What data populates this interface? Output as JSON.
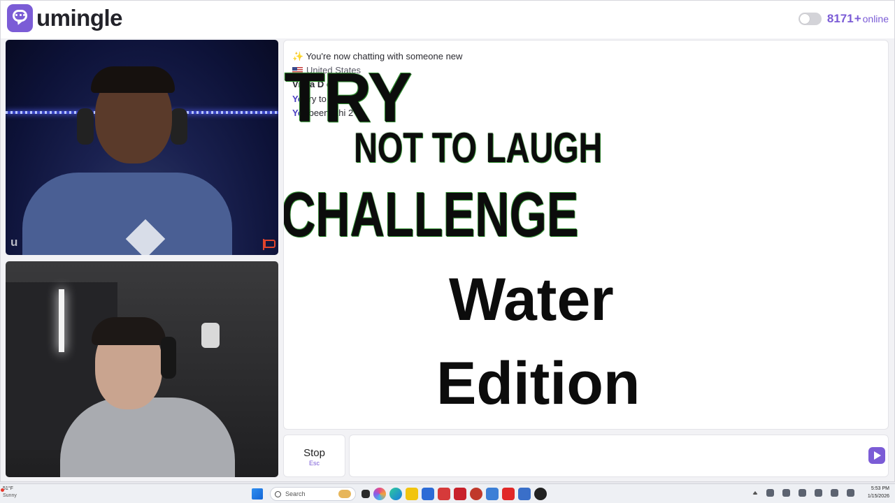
{
  "header": {
    "brand": "umingle",
    "online_count": "8171",
    "online_plus": "+",
    "online_label": "online",
    "accent_color": "#7b5cd6"
  },
  "stranger_video": {
    "watermark": "u"
  },
  "chat": {
    "system_message": "✨ You're now chatting with someone new",
    "country": "United States",
    "interest_line": "Vi     Ca    D    e",
    "messages": [
      {
        "sender": "You",
        "text": "ry to      augh"
      },
      {
        "sender": "You",
        "text": "been l     thi    2 hr"
      }
    ],
    "overlay": {
      "try": "TRY",
      "not_to_laugh": "NOT TO LAUGH",
      "challenge": "CHALLENGE",
      "water": "Water",
      "edition": "Edition"
    }
  },
  "controls": {
    "stop_label": "Stop",
    "stop_hint": "Esc",
    "message_placeholder": "",
    "send_icon": "send-arrow-icon"
  },
  "taskbar": {
    "weather_temp": "51°F",
    "weather_desc": "Sunny",
    "search_placeholder": "Search",
    "time": "5:53 PM",
    "date": "1/15/2026"
  }
}
